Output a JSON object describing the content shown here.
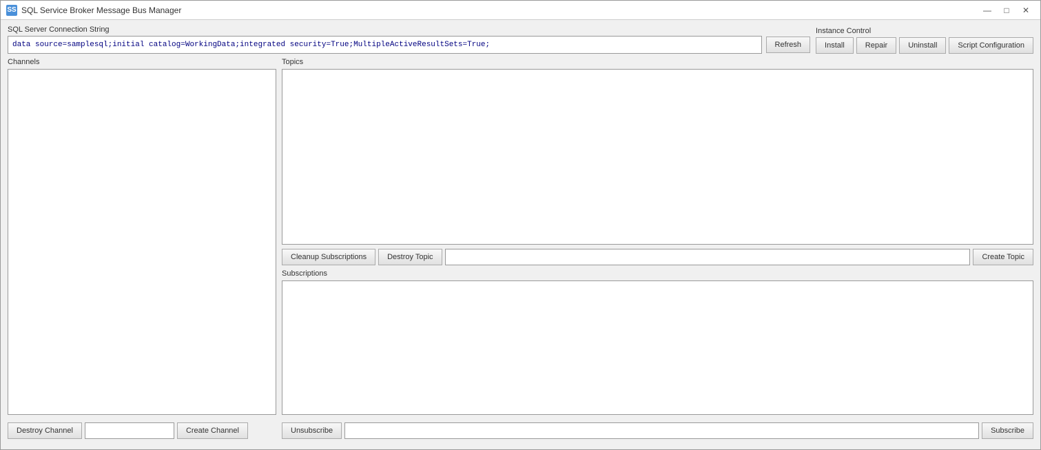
{
  "window": {
    "title": "SQL Service Broker Message Bus Manager",
    "icon_label": "SS"
  },
  "title_controls": {
    "minimize": "—",
    "maximize": "□",
    "close": "✕"
  },
  "connection": {
    "label": "SQL Server Connection String",
    "value": "data source=samplesql;initial catalog=WorkingData;integrated security=True;MultipleActiveResultSets=True;",
    "refresh_btn": "Refresh"
  },
  "instance_control": {
    "label": "Instance Control",
    "install_btn": "Install",
    "repair_btn": "Repair",
    "uninstall_btn": "Uninstall",
    "script_btn": "Script Configuration"
  },
  "channels": {
    "label": "Channels",
    "items": []
  },
  "topics": {
    "label": "Topics",
    "items": [],
    "cleanup_btn": "Cleanup Subscriptions",
    "destroy_btn": "Destroy Topic",
    "topic_input_placeholder": "",
    "create_btn": "Create Topic"
  },
  "subscriptions": {
    "label": "Subscriptions",
    "items": [],
    "unsubscribe_btn": "Unsubscribe",
    "subscribe_input_placeholder": "",
    "subscribe_btn": "Subscribe"
  },
  "channels_bottom": {
    "destroy_btn": "Destroy Channel",
    "channel_input_placeholder": "",
    "create_btn": "Create Channel"
  }
}
